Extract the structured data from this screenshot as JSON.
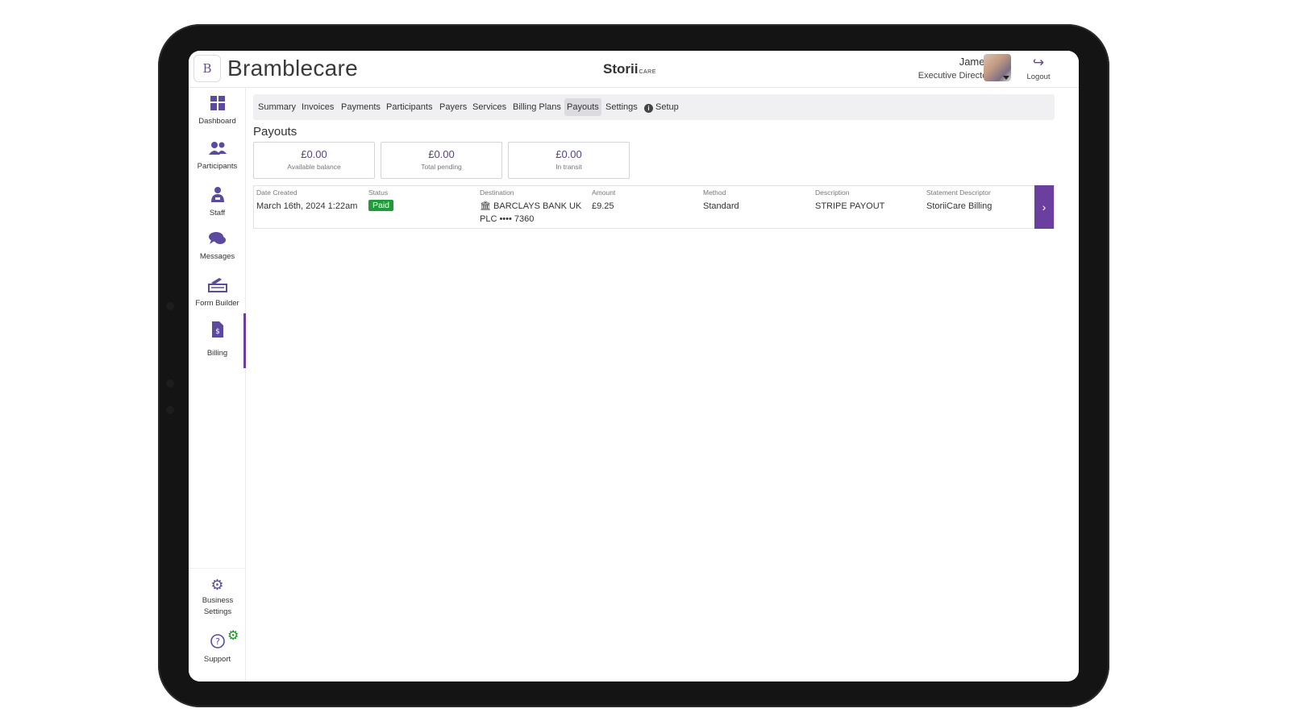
{
  "header": {
    "logo_letter": "B",
    "brand": "Bramblecare",
    "product_name": "Storii",
    "product_suffix": "CARE",
    "user_name": "James",
    "user_role": "Executive Director",
    "logout_label": "Logout"
  },
  "sidebar": {
    "items": [
      {
        "label": "Dashboard",
        "icon": "dashboard-icon"
      },
      {
        "label": "Participants",
        "icon": "participants-icon"
      },
      {
        "label": "Staff",
        "icon": "staff-icon"
      },
      {
        "label": "Messages",
        "icon": "messages-icon"
      },
      {
        "label": "Form Builder",
        "icon": "form-builder-icon"
      },
      {
        "label": "Billing",
        "icon": "billing-icon"
      }
    ],
    "bottom": [
      {
        "label": "Business Settings",
        "icon": "gear-icon"
      },
      {
        "label": "Support",
        "icon": "question-icon"
      }
    ],
    "active": "Billing"
  },
  "tabs": [
    {
      "label": "Summary"
    },
    {
      "label": "Invoices"
    },
    {
      "label": "Payments"
    },
    {
      "label": "Participants"
    },
    {
      "label": "Payers"
    },
    {
      "label": "Services"
    },
    {
      "label": "Billing Plans"
    },
    {
      "label": "Payouts"
    },
    {
      "label": "Settings"
    },
    {
      "label": "Setup"
    }
  ],
  "active_tab": "Payouts",
  "page": {
    "title": "Payouts",
    "cards": [
      {
        "amount": "£0.00",
        "caption": "Available balance"
      },
      {
        "amount": "£0.00",
        "caption": "Total pending"
      },
      {
        "amount": "£0.00",
        "caption": "In transit"
      }
    ],
    "columns": [
      "Date Created",
      "Status",
      "Destination",
      "Amount",
      "Method",
      "Description",
      "Statement Descriptor"
    ],
    "rows": [
      {
        "date_created": "March 16th, 2024 1:22am",
        "status": "Paid",
        "destination_line1": "BARCLAYS BANK UK",
        "destination_line2": "PLC •••• 7360",
        "amount": "£9.25",
        "method": "Standard",
        "description": "STRIPE PAYOUT",
        "statement_descriptor": "StoriiCare Billing"
      }
    ]
  },
  "colors": {
    "accent": "#6b3fa0",
    "paid_badge": "#1f9b3a",
    "nav_icon": "#5b4a9e"
  }
}
